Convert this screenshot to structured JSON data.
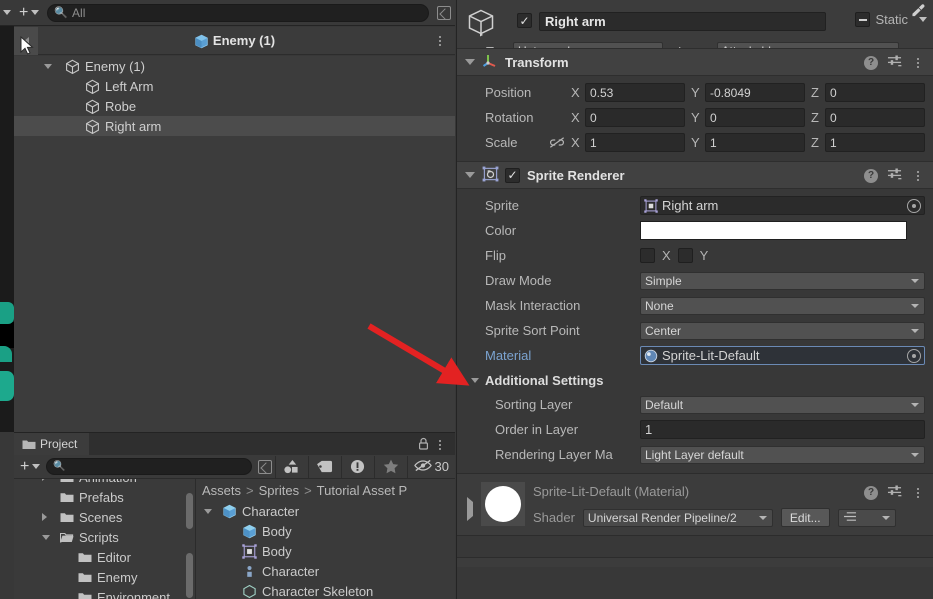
{
  "hierarchy": {
    "toolbar": {
      "add_label": "+",
      "search_placeholder": "All",
      "search_icon": "search-icon",
      "expand_icon": "expand-icon"
    },
    "breadcrumb": {
      "back_icon": "back-arrow-icon",
      "title": "Enemy (1)",
      "menu_icon": "kebab-menu-icon"
    },
    "tree": [
      {
        "label": "Enemy (1)",
        "depth": 0,
        "expanded": true,
        "selected": false
      },
      {
        "label": "Left Arm",
        "depth": 1,
        "expanded": false,
        "selected": false
      },
      {
        "label": "Robe",
        "depth": 1,
        "expanded": false,
        "selected": false
      },
      {
        "label": "Right arm",
        "depth": 1,
        "expanded": false,
        "selected": true
      }
    ]
  },
  "project": {
    "tab_label": "Project",
    "lock_icon": "lock-icon",
    "menu_icon": "kebab-menu-icon",
    "toolbar": {
      "add_label": "+",
      "search_placeholder": "",
      "icons": [
        "shapes-filter-icon",
        "tag-icon",
        "warning-icon",
        "star-icon",
        "eye-slash-icon"
      ],
      "hidden_count": "30"
    },
    "tree": [
      {
        "label": "Animation",
        "depth": 1,
        "has_arrow": true,
        "clipped": true
      },
      {
        "label": "Prefabs",
        "depth": 1,
        "has_arrow": false,
        "clipped": false
      },
      {
        "label": "Scenes",
        "depth": 1,
        "has_arrow": true,
        "clipped": false
      },
      {
        "label": "Scripts",
        "depth": 1,
        "has_arrow": true,
        "expanded": true,
        "clipped": false
      },
      {
        "label": "Editor",
        "depth": 2,
        "has_arrow": false,
        "clipped": false
      },
      {
        "label": "Enemy",
        "depth": 2,
        "has_arrow": false,
        "clipped": false
      },
      {
        "label": "Environment",
        "depth": 2,
        "has_arrow": false,
        "clipped": true
      }
    ],
    "breadcrumb": [
      "Assets",
      "Sprites",
      "Tutorial Asset P"
    ],
    "items": [
      {
        "label": "Character",
        "depth": 0,
        "icon": "prefab-icon",
        "expanded": true
      },
      {
        "label": "Body",
        "depth": 1,
        "icon": "prefab-icon"
      },
      {
        "label": "Body",
        "depth": 1,
        "icon": "sprite-icon"
      },
      {
        "label": "Character",
        "depth": 1,
        "icon": "script-icon"
      },
      {
        "label": "Character Skeleton",
        "depth": 1,
        "icon": "mesh-icon",
        "clipped": true
      }
    ]
  },
  "inspector": {
    "gameobject": {
      "icon": "gameobject-cube-icon",
      "enabled": true,
      "name": "Right arm",
      "static_label": "Static",
      "static_state": "mixed",
      "tag_label": "Tag",
      "tag_value": "Untagged",
      "layer_label": "Layer",
      "layer_value": "Attackable"
    },
    "components": [
      {
        "name": "Transform",
        "icon": "transform-axis-icon",
        "expanded": true,
        "has_enable_toggle": false,
        "header_icons": [
          "help-icon",
          "preset-icon",
          "kebab-menu-icon"
        ],
        "vectors": [
          {
            "label": "Position",
            "x": "0.53",
            "y": "-0.8049\u0001",
            "z": "0",
            "linked": false
          },
          {
            "label": "Rotation",
            "x": "0",
            "y": "0",
            "z": "0",
            "linked": false
          },
          {
            "label": "Scale",
            "x": "1",
            "y": "1",
            "z": "1",
            "linked": false,
            "link_icon": "broken-link-icon"
          }
        ],
        "axes": [
          "X",
          "Y",
          "Z"
        ]
      },
      {
        "name": "Sprite Renderer",
        "icon": "sprite-renderer-icon",
        "expanded": true,
        "has_enable_toggle": true,
        "enabled": true,
        "header_icons": [
          "help-icon",
          "preset-icon",
          "kebab-menu-icon"
        ],
        "properties": [
          {
            "label": "Sprite",
            "type": "object",
            "value": "Right arm",
            "icon": "sprite-icon"
          },
          {
            "label": "Color",
            "type": "color",
            "value": "#FFFFFF",
            "picker_icon": "eyedropper-icon"
          },
          {
            "label": "Flip",
            "type": "flip",
            "x_label": "X",
            "y_label": "Y",
            "x": false,
            "y": false
          },
          {
            "label": "Draw Mode",
            "type": "dropdown",
            "value": "Simple"
          },
          {
            "label": "Mask Interaction",
            "type": "dropdown",
            "value": "None"
          },
          {
            "label": "Sprite Sort Point",
            "type": "dropdown",
            "value": "Center"
          },
          {
            "label": "Material",
            "type": "object",
            "value": "Sprite-Lit-Default",
            "icon": "material-icon",
            "highlighted": true
          }
        ],
        "additional_settings": {
          "label": "Additional Settings",
          "expanded": true,
          "properties": [
            {
              "label": "Sorting Layer",
              "type": "dropdown",
              "value": "Default"
            },
            {
              "label": "Order in Layer",
              "type": "text",
              "value": "1"
            },
            {
              "label": "Rendering Layer Ma",
              "type": "dropdown",
              "value": "Light Layer default"
            }
          ]
        }
      }
    ],
    "material_preview": {
      "title": "Sprite-Lit-Default (Material)",
      "shader_label": "Shader",
      "shader_value": "Universal Render Pipeline/2",
      "edit_label": "Edit...",
      "header_icons": [
        "help-icon",
        "preset-icon",
        "kebab-menu-icon"
      ],
      "expander_icon": "triangle-right-icon"
    }
  },
  "annotation": {
    "arrow_color": "#E32222",
    "arrow_target": "Material"
  },
  "colors": {
    "panel_bg": "#383838",
    "header_bg": "#414141",
    "field_bg": "#2a2a2a",
    "dropdown_bg": "#515151",
    "selection": "#4c4c4c",
    "highlight_blue": "#6b8ab5",
    "label_link": "#7ba3d0",
    "accent_teal": "#1aa085"
  }
}
